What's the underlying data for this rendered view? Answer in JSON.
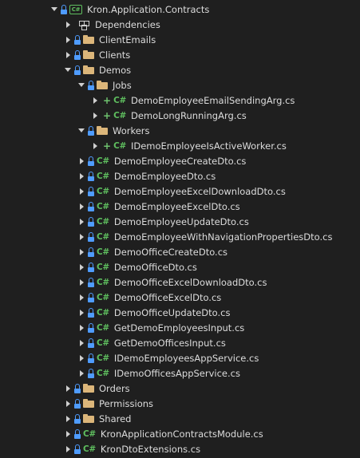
{
  "tree": [
    {
      "label": "Kron.Application.Contracts",
      "kind": "project",
      "expander": "expanded",
      "lock": true,
      "plus": false,
      "indent": 0
    },
    {
      "label": "Dependencies",
      "kind": "dependencies",
      "expander": "collapsed",
      "lock": false,
      "plus": false,
      "indent": 1
    },
    {
      "label": "ClientEmails",
      "kind": "folder",
      "expander": "collapsed",
      "lock": true,
      "plus": false,
      "indent": 1
    },
    {
      "label": "Clients",
      "kind": "folder",
      "expander": "collapsed",
      "lock": true,
      "plus": false,
      "indent": 1
    },
    {
      "label": "Demos",
      "kind": "folder",
      "expander": "expanded",
      "lock": true,
      "plus": false,
      "indent": 1
    },
    {
      "label": "Jobs",
      "kind": "folder",
      "expander": "expanded",
      "lock": true,
      "plus": false,
      "indent": 2
    },
    {
      "label": "DemoEmployeeEmailSendingArg.cs",
      "kind": "cs",
      "expander": "collapsed",
      "lock": false,
      "plus": true,
      "indent": 3
    },
    {
      "label": "DemoLongRunningArg.cs",
      "kind": "cs",
      "expander": "collapsed",
      "lock": false,
      "plus": true,
      "indent": 3
    },
    {
      "label": "Workers",
      "kind": "folder",
      "expander": "expanded",
      "lock": true,
      "plus": false,
      "indent": 2
    },
    {
      "label": "IDemoEmployeeIsActiveWorker.cs",
      "kind": "cs",
      "expander": "collapsed",
      "lock": false,
      "plus": true,
      "indent": 3
    },
    {
      "label": "DemoEmployeeCreateDto.cs",
      "kind": "cs",
      "expander": "collapsed",
      "lock": true,
      "plus": false,
      "indent": 2
    },
    {
      "label": "DemoEmployeeDto.cs",
      "kind": "cs",
      "expander": "collapsed",
      "lock": true,
      "plus": false,
      "indent": 2
    },
    {
      "label": "DemoEmployeeExcelDownloadDto.cs",
      "kind": "cs",
      "expander": "collapsed",
      "lock": true,
      "plus": false,
      "indent": 2
    },
    {
      "label": "DemoEmployeeExcelDto.cs",
      "kind": "cs",
      "expander": "collapsed",
      "lock": true,
      "plus": false,
      "indent": 2
    },
    {
      "label": "DemoEmployeeUpdateDto.cs",
      "kind": "cs",
      "expander": "collapsed",
      "lock": true,
      "plus": false,
      "indent": 2
    },
    {
      "label": "DemoEmployeeWithNavigationPropertiesDto.cs",
      "kind": "cs",
      "expander": "collapsed",
      "lock": true,
      "plus": false,
      "indent": 2
    },
    {
      "label": "DemoOfficeCreateDto.cs",
      "kind": "cs",
      "expander": "collapsed",
      "lock": true,
      "plus": false,
      "indent": 2
    },
    {
      "label": "DemoOfficeDto.cs",
      "kind": "cs",
      "expander": "collapsed",
      "lock": true,
      "plus": false,
      "indent": 2
    },
    {
      "label": "DemoOfficeExcelDownloadDto.cs",
      "kind": "cs",
      "expander": "collapsed",
      "lock": true,
      "plus": false,
      "indent": 2
    },
    {
      "label": "DemoOfficeExcelDto.cs",
      "kind": "cs",
      "expander": "collapsed",
      "lock": true,
      "plus": false,
      "indent": 2
    },
    {
      "label": "DemoOfficeUpdateDto.cs",
      "kind": "cs",
      "expander": "collapsed",
      "lock": true,
      "plus": false,
      "indent": 2
    },
    {
      "label": "GetDemoEmployeesInput.cs",
      "kind": "cs",
      "expander": "collapsed",
      "lock": true,
      "plus": false,
      "indent": 2
    },
    {
      "label": "GetDemoOfficesInput.cs",
      "kind": "cs",
      "expander": "collapsed",
      "lock": true,
      "plus": false,
      "indent": 2
    },
    {
      "label": "IDemoEmployeesAppService.cs",
      "kind": "cs",
      "expander": "collapsed",
      "lock": true,
      "plus": false,
      "indent": 2
    },
    {
      "label": "IDemoOfficesAppService.cs",
      "kind": "cs",
      "expander": "collapsed",
      "lock": true,
      "plus": false,
      "indent": 2
    },
    {
      "label": "Orders",
      "kind": "folder",
      "expander": "collapsed",
      "lock": true,
      "plus": false,
      "indent": 1
    },
    {
      "label": "Permissions",
      "kind": "folder",
      "expander": "collapsed",
      "lock": true,
      "plus": false,
      "indent": 1
    },
    {
      "label": "Shared",
      "kind": "folder",
      "expander": "collapsed",
      "lock": true,
      "plus": false,
      "indent": 1
    },
    {
      "label": "KronApplicationContractsModule.cs",
      "kind": "cs",
      "expander": "collapsed",
      "lock": true,
      "plus": false,
      "indent": 1
    },
    {
      "label": "KronDtoExtensions.cs",
      "kind": "cs",
      "expander": "collapsed",
      "lock": true,
      "plus": false,
      "indent": 1
    }
  ],
  "icons": {
    "cs_glyph": "C#",
    "project_glyph": "C#",
    "plus_glyph": "+"
  },
  "colors": {
    "background": "#1f1f1f",
    "text": "#dcdcdc",
    "lock": "#4f9cff",
    "folder": "#dcb67a",
    "csharp": "#5fbf5f",
    "added": "#6fc36f"
  }
}
